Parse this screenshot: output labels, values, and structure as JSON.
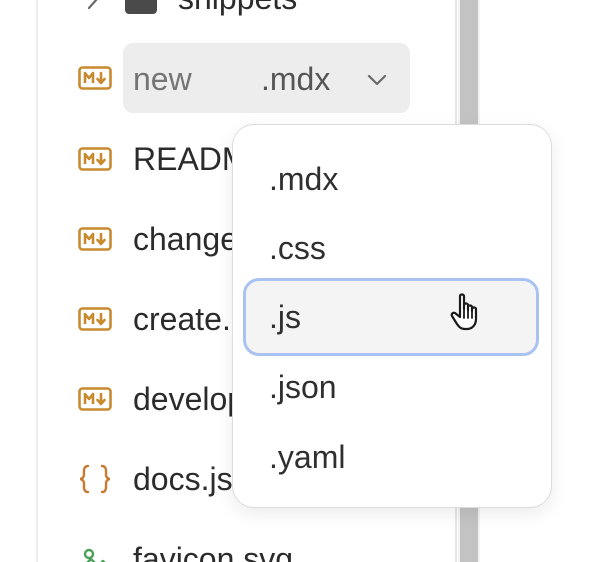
{
  "sidebar": {
    "folder": {
      "name": "snippets"
    },
    "new_file": {
      "placeholder": "new",
      "extension": ".mdx"
    },
    "files": [
      {
        "name": "README.md",
        "icon": "markdown-icon"
      },
      {
        "name": "changelog.mdx",
        "icon": "markdown-icon"
      },
      {
        "name": "create.mdx",
        "icon": "markdown-icon"
      },
      {
        "name": "development.mdx",
        "icon": "markdown-icon"
      },
      {
        "name": "docs.json",
        "icon": "json-braces-icon"
      },
      {
        "name": "favicon.svg",
        "icon": "image-icon"
      }
    ]
  },
  "extension_dropdown": {
    "options": [
      ".mdx",
      ".css",
      ".js",
      ".json",
      ".yaml"
    ],
    "highlighted": ".js"
  },
  "colors": {
    "markdown_icon": "#c88a2e",
    "json_icon": "#c87a2e",
    "image_icon": "#4aa05a",
    "highlight_border": "#a9c2f2",
    "scrollbar_thumb": "#c3c3c3"
  }
}
